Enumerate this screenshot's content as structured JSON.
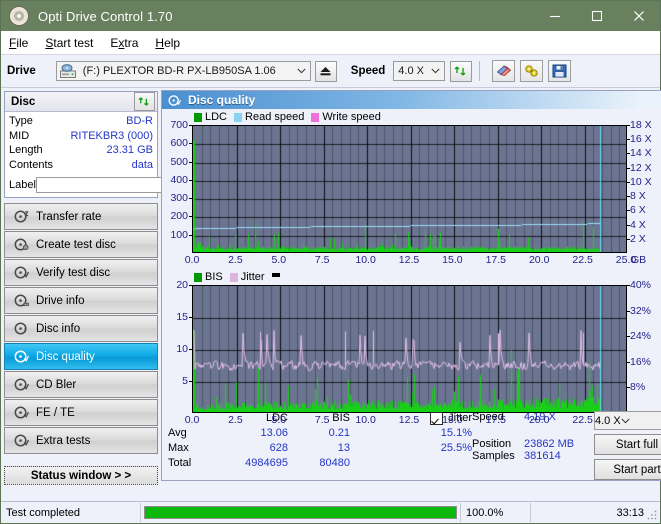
{
  "window": {
    "title": "Opti Drive Control 1.70",
    "minimize": "minimize-icon",
    "maximize": "maximize-icon",
    "close": "close-icon"
  },
  "menu": {
    "items": [
      {
        "label": "File",
        "accel": "F"
      },
      {
        "label": "Start test",
        "accel": "S"
      },
      {
        "label": "Extra",
        "accel": "x"
      },
      {
        "label": "Help",
        "accel": "H"
      }
    ]
  },
  "drivebar": {
    "drive_label": "Drive",
    "drive_value": "(F:)  PLEXTOR BD-R  PX-LB950SA 1.06",
    "eject_icon": "eject-icon",
    "speed_label": "Speed",
    "speed_value": "4.0 X",
    "refresh_icon": "refresh-icon",
    "erase_icon": "eraser-icon",
    "settings_icon": "plug-icon",
    "save_icon": "floppy-save-icon"
  },
  "disc": {
    "header": "Disc",
    "refresh_icon": "refresh-icon",
    "rows": [
      {
        "key": "Type",
        "value": "BD-R"
      },
      {
        "key": "MID",
        "value": "RITEKBR3 (000)"
      },
      {
        "key": "Length",
        "value": "23.31 GB"
      },
      {
        "key": "Contents",
        "value": "data"
      }
    ],
    "label_key": "Label",
    "label_value": "",
    "label_placeholder": "",
    "disc_button_icon": "disc-icon"
  },
  "nav": {
    "items": [
      {
        "label": "Transfer rate",
        "icon": "disc-transfer-icon",
        "active": false
      },
      {
        "label": "Create test disc",
        "icon": "disc-create-icon",
        "active": false
      },
      {
        "label": "Verify test disc",
        "icon": "disc-verify-icon",
        "active": false
      },
      {
        "label": "Drive info",
        "icon": "disc-drive-icon",
        "active": false
      },
      {
        "label": "Disc info",
        "icon": "disc-info-icon",
        "active": false
      },
      {
        "label": "Disc quality",
        "icon": "disc-quality-icon",
        "active": true
      },
      {
        "label": "CD Bler",
        "icon": "disc-bler-icon",
        "active": false
      },
      {
        "label": "FE / TE",
        "icon": "disc-fete-icon",
        "active": false
      },
      {
        "label": "Extra tests",
        "icon": "disc-extra-icon",
        "active": false
      }
    ],
    "status_button": "Status window > >"
  },
  "chart_panel": {
    "title": "Disc quality",
    "title_icon": "disc-quality-icon"
  },
  "chart_data": [
    {
      "type": "area",
      "id": "ldc-chart",
      "title": "",
      "xlabel": "GB",
      "ylabel": "",
      "xlim": [
        0.0,
        25.0
      ],
      "ylim": [
        0,
        700
      ],
      "y2lim": [
        0,
        18
      ],
      "y2label": "X",
      "xticks": [
        "0.0",
        "2.5",
        "5.0",
        "7.5",
        "10.0",
        "12.5",
        "15.0",
        "17.5",
        "20.0",
        "22.5",
        "25.0"
      ],
      "yticks": [
        "100",
        "200",
        "300",
        "400",
        "500",
        "600",
        "700"
      ],
      "y2ticks": [
        "2 X",
        "4 X",
        "6 X",
        "8 X",
        "10 X",
        "12 X",
        "14 X",
        "16 X",
        "18 X"
      ],
      "x_unit": "GB",
      "grid": true,
      "legend_position": "top-left",
      "legend": [
        {
          "name": "LDC",
          "color": "#009900"
        },
        {
          "name": "Read speed",
          "color": "#87d3f0"
        },
        {
          "name": "Write speed",
          "color": "#f070d8"
        }
      ],
      "series": [
        {
          "name": "LDC",
          "color": "#00d000",
          "kind": "area",
          "avg": 13.06,
          "max": 628,
          "total": 4984695,
          "data_end_gb": 23.4
        },
        {
          "name": "Read speed",
          "color": "#87d3f0",
          "kind": "line",
          "start_x": 4.0,
          "end_x": 4.4,
          "points": [
            [
              0.0,
              3.6
            ],
            [
              1.2,
              3.7
            ],
            [
              3.8,
              3.8
            ],
            [
              7.0,
              3.9
            ],
            [
              10.0,
              4.0
            ],
            [
              13.5,
              4.05
            ],
            [
              16.5,
              4.1
            ],
            [
              19.5,
              4.2
            ],
            [
              22.5,
              4.3
            ],
            [
              23.4,
              4.4
            ]
          ]
        }
      ],
      "cursor_x_gb": 23.4
    },
    {
      "type": "area",
      "id": "bis-jitter-chart",
      "title": "",
      "xlabel": "GB",
      "ylabel": "",
      "xlim": [
        0.0,
        25.0
      ],
      "ylim": [
        0,
        20
      ],
      "y2lim": [
        0,
        40
      ],
      "y2label": "%",
      "xticks": [
        "0.0",
        "2.5",
        "5.0",
        "7.5",
        "10.0",
        "12.5",
        "15.0",
        "17.5",
        "20.0",
        "22.5",
        "25.0"
      ],
      "yticks": [
        "5",
        "10",
        "15",
        "20"
      ],
      "y2ticks": [
        "8%",
        "16%",
        "24%",
        "32%",
        "40%"
      ],
      "x_unit": "GB",
      "grid": true,
      "legend_position": "top-left",
      "legend": [
        {
          "name": "BIS",
          "color": "#009900"
        },
        {
          "name": "Jitter",
          "color": "#dcb4e0"
        }
      ],
      "series": [
        {
          "name": "BIS",
          "color": "#00d000",
          "kind": "area",
          "avg": 0.21,
          "max": 13,
          "total": 80480,
          "data_end_gb": 23.4
        },
        {
          "name": "Jitter",
          "color": "#e0b8e4",
          "kind": "line",
          "avg_pct": 15.1,
          "max_pct": 25.5,
          "mean_level": 7.6
        }
      ],
      "cursor_x_gb": 23.4
    }
  ],
  "stats": {
    "columns": [
      "LDC",
      "BIS"
    ],
    "jitter_label": "Jitter",
    "jitter_checked": true,
    "rows": [
      {
        "name": "Avg",
        "ldc": "13.06",
        "bis": "0.21",
        "jitter": "15.1%"
      },
      {
        "name": "Max",
        "ldc": "628",
        "bis": "13",
        "jitter": "25.5%"
      },
      {
        "name": "Total",
        "ldc": "4984695",
        "bis": "80480",
        "jitter": ""
      }
    ],
    "speed_label": "Speed",
    "speed_value": "4.19 X",
    "position_label": "Position",
    "position_value": "23862 MB",
    "samples_label": "Samples",
    "samples_value": "381614",
    "speed_select": "4.0 X",
    "start_full": "Start full",
    "start_part": "Start part"
  },
  "statusbar": {
    "message": "Test completed",
    "progress_percent": 100.0,
    "progress_text": "100.0%",
    "elapsed": "33:13"
  }
}
